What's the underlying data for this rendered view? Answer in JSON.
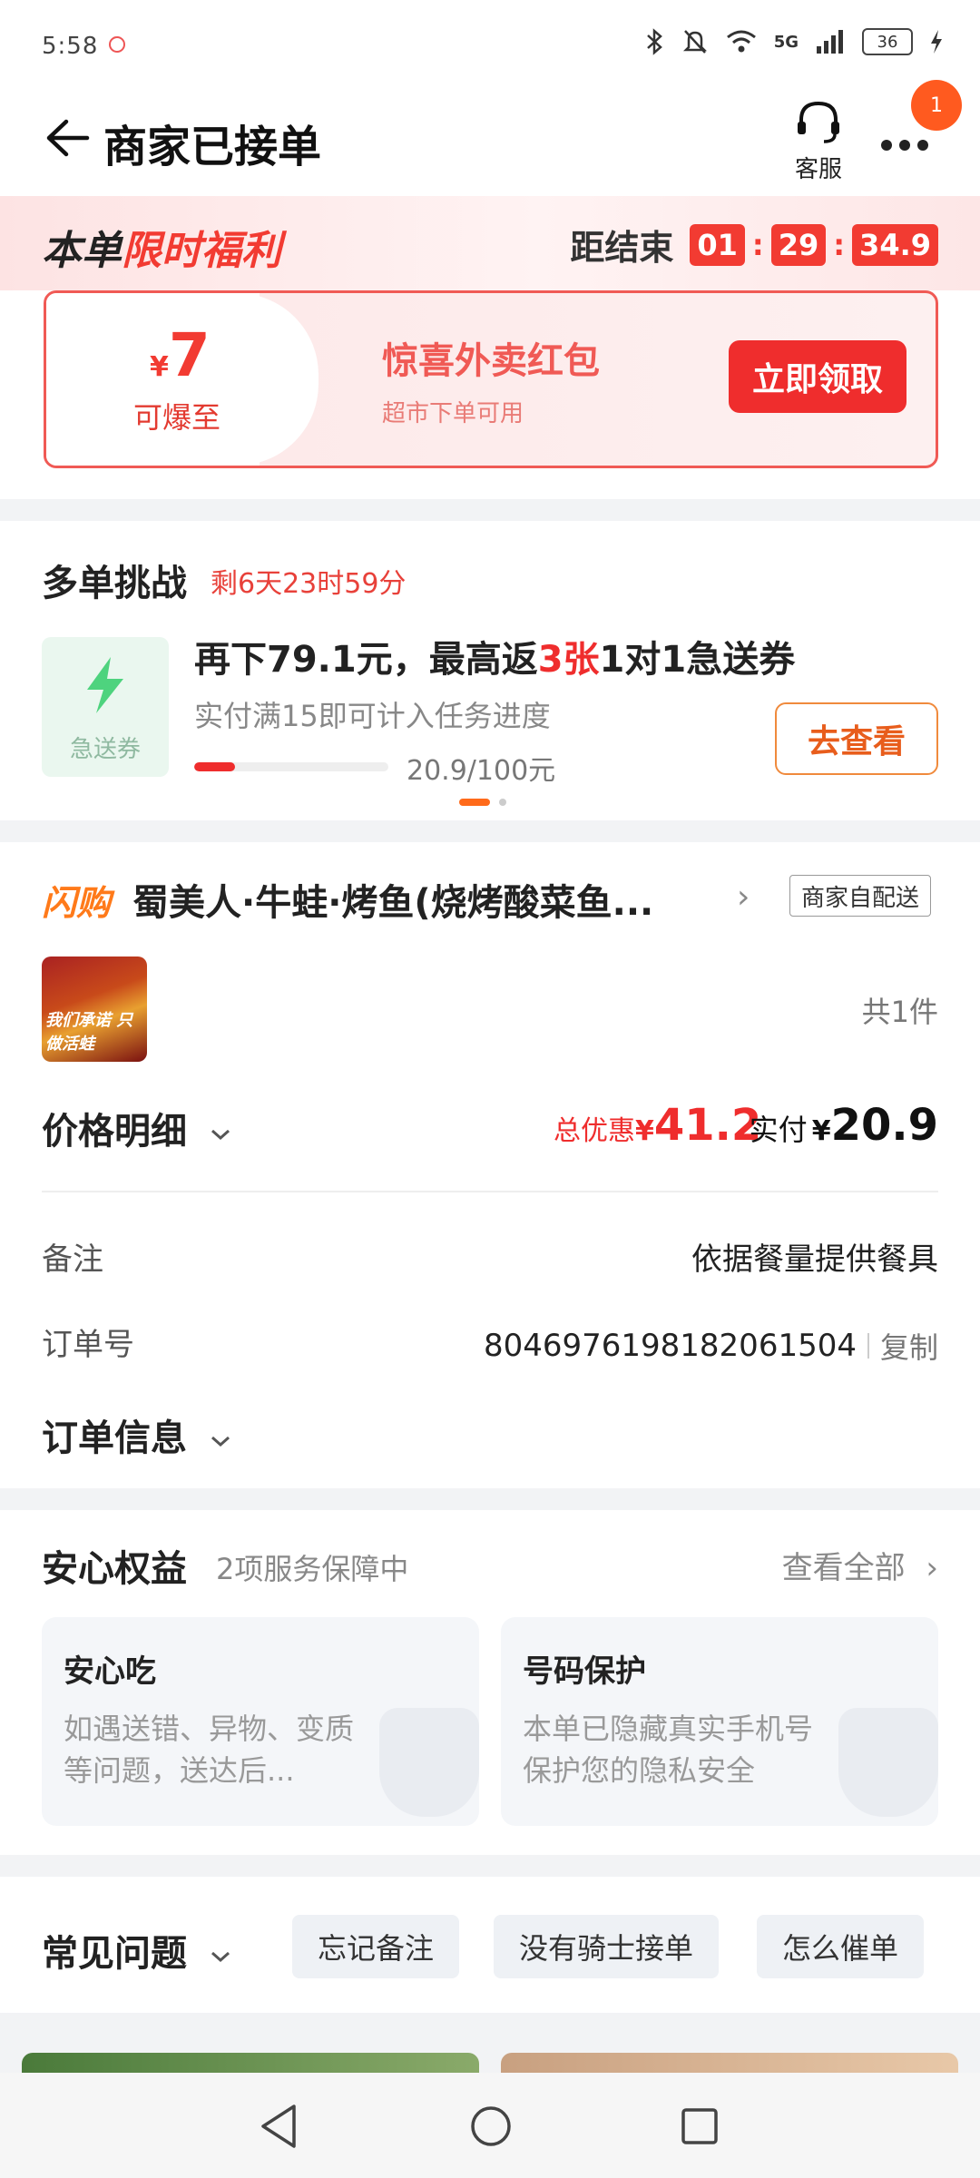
{
  "status_bar": {
    "time": "5:58",
    "battery": "36",
    "network": "5G"
  },
  "header": {
    "title": "商家已接单",
    "service_label": "客服",
    "badge": "1"
  },
  "promo": {
    "title_part1": "本单",
    "title_part2": "限时福利",
    "countdown_label": "距结束",
    "countdown": [
      "01",
      "29",
      "34.9"
    ],
    "coupon_currency": "¥",
    "coupon_amount": "7",
    "coupon_caption": "可爆至",
    "coupon_name": "惊喜外卖红包",
    "coupon_sub": "超市下单可用",
    "coupon_button": "立即领取"
  },
  "challenge": {
    "title": "多单挑战",
    "time_left": "剩6天23时59分",
    "icon_label": "急送券",
    "line1_a": "再下79.1元，最高返",
    "line1_hl": "3张",
    "line1_b": "1对1急送券",
    "line2": "实付满15即可计入任务进度",
    "progress_text": "20.9/100元",
    "progress_fraction": 0.209,
    "button": "去查看"
  },
  "order": {
    "brand_tag": "闪购",
    "shop_name": "蜀美人·牛蛙·烤鱼(烧烤酸菜鱼...",
    "delivery_tag": "商家自配送",
    "food_img_text": "我们承诺 只做活蛙",
    "item_count": "共1件",
    "price_detail_label": "价格明细",
    "discount_label": "总优惠",
    "discount_currency": "¥",
    "discount_amount": "41.2",
    "paid_label": "实付",
    "paid_currency": "¥",
    "paid_amount": "20.9",
    "remark_label": "备注",
    "remark_value": "依据餐量提供餐具",
    "order_no_label": "订单号",
    "order_no": "8046976198182061504",
    "copy_label": "复制",
    "order_info_label": "订单信息"
  },
  "guarantee": {
    "title": "安心权益",
    "sub": "2项服务保障中",
    "view_all": "查看全部",
    "cards": [
      {
        "title": "安心吃",
        "text": "如遇送错、异物、变质等问题，送达后..."
      },
      {
        "title": "号码保护",
        "text": "本单已隐藏真实手机号保护您的隐私安全"
      }
    ]
  },
  "faq": {
    "title": "常见问题",
    "chips": [
      "忘记备注",
      "没有骑士接单",
      "怎么催单"
    ]
  },
  "colors": {
    "accent_red": "#ef2d2d",
    "accent_orange": "#ff7a1a"
  }
}
